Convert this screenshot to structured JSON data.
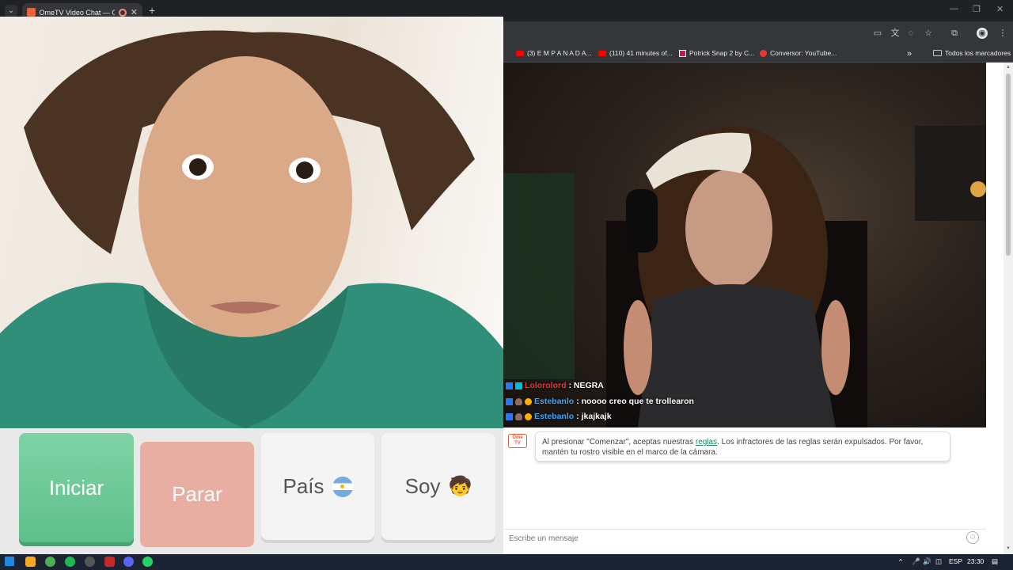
{
  "browser": {
    "tab_title": "OmeTV Video Chat — Ome",
    "tab_close": "✕",
    "new_tab": "+",
    "tabs_dropdown": "⌄",
    "window_controls": [
      "—",
      "❐",
      "✕"
    ],
    "bookmarks": [
      {
        "label": "(3) E M P A N A D A...",
        "icon": "youtube-icon"
      },
      {
        "label": "(110) 41 minutes of...",
        "icon": "youtube-icon"
      },
      {
        "label": "Potrick Snap 2 by C...",
        "icon": "pixel-icon"
      },
      {
        "label": "Conversor: YouTube...",
        "icon": "converter-icon"
      }
    ],
    "bookmarks_overflow": "»",
    "all_bookmarks": "Todos los marcadores"
  },
  "controls": {
    "start": "Iniciar",
    "stop": "Parar",
    "country": "País",
    "gender": "Soy",
    "gender_emoji": "🧒"
  },
  "chat_overlay": [
    {
      "nick": "Lolorolord",
      "text": ": NEGRA",
      "color": "#e53935"
    },
    {
      "nick": "Estebanlo",
      "text": ": noooo creo que te trollearon",
      "color": "#42a5f5"
    },
    {
      "nick": "Estebanlo",
      "text": ": jkajkajk",
      "color": "#42a5f5"
    }
  ],
  "chat": {
    "logo_text": "Ome TV",
    "system_before_link": "Al presionar \"Comenzar\", aceptas nuestras ",
    "system_link": "reglas",
    "system_after_link": ". Los infractores de las reglas serán expulsados. Por favor, mantén tu rostro visible en el marco de la cámara.",
    "input_placeholder": "Escribe un mensaje",
    "emoji_button": "☺"
  },
  "taskbar": {
    "language": "ESP",
    "time": "23:30",
    "tray_chevron": "^"
  },
  "colors": {
    "start_button": "#6cc996",
    "stop_button": "#e8aea2",
    "link": "#1a7f64"
  }
}
